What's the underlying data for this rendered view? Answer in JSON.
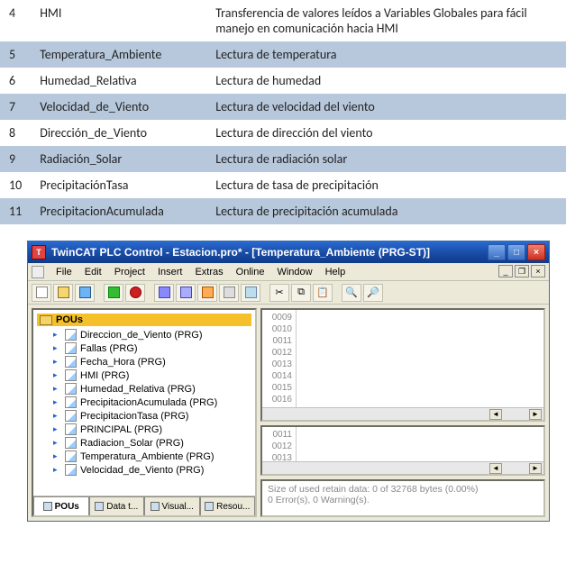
{
  "table": {
    "rows": [
      {
        "num": "4",
        "name": "HMI",
        "desc": "Transferencia de valores leídos a Variables Globales para fácil manejo en comunicación hacia HMI",
        "band": false
      },
      {
        "num": "5",
        "name": "Temperatura_Ambiente",
        "desc": "Lectura de temperatura",
        "band": true
      },
      {
        "num": "6",
        "name": "Humedad_Relativa",
        "desc": "Lectura de humedad",
        "band": false
      },
      {
        "num": "7",
        "name": "Velocidad_de_Viento",
        "desc": "Lectura de velocidad del viento",
        "band": true
      },
      {
        "num": "8",
        "name": "Dirección_de_Viento",
        "desc": "Lectura de dirección del viento",
        "band": false
      },
      {
        "num": "9",
        "name": "Radiación_Solar",
        "desc": "Lectura de radiación solar",
        "band": true
      },
      {
        "num": "10",
        "name": "PrecipitaciónTasa",
        "desc": "Lectura de tasa de precipitación",
        "band": false
      },
      {
        "num": "11",
        "name": "PrecipitacionAcumulada",
        "desc": "Lectura de precipitación acumulada",
        "band": true
      }
    ]
  },
  "app": {
    "title": "TwinCAT PLC Control - Estacion.pro* - [Temperatura_Ambiente (PRG-ST)]",
    "menu": [
      "File",
      "Edit",
      "Project",
      "Insert",
      "Extras",
      "Online",
      "Window",
      "Help"
    ],
    "tree_root": "POUs",
    "tree_items": [
      "Direccion_de_Viento (PRG)",
      "Fallas (PRG)",
      "Fecha_Hora (PRG)",
      "HMI (PRG)",
      "Humedad_Relativa (PRG)",
      "PrecipitacionAcumulada (PRG)",
      "PrecipitacionTasa (PRG)",
      "PRINCIPAL (PRG)",
      "Radiacion_Solar (PRG)",
      "Temperatura_Ambiente (PRG)",
      "Velocidad_de_Viento (PRG)"
    ],
    "tabs": [
      {
        "label": "POUs",
        "active": true
      },
      {
        "label": "Data t...",
        "active": false
      },
      {
        "label": "Visual...",
        "active": false
      },
      {
        "label": "Resou...",
        "active": false
      }
    ],
    "gutter1": [
      "0009",
      "0010",
      "0011",
      "0012",
      "0013",
      "0014",
      "0015",
      "0016"
    ],
    "gutter2": [
      "0011",
      "0012",
      "0013"
    ],
    "status": {
      "line1": "Size of used retain data: 0 of 32768 bytes (0.00%)",
      "line2": "0 Error(s), 0 Warning(s)."
    }
  }
}
